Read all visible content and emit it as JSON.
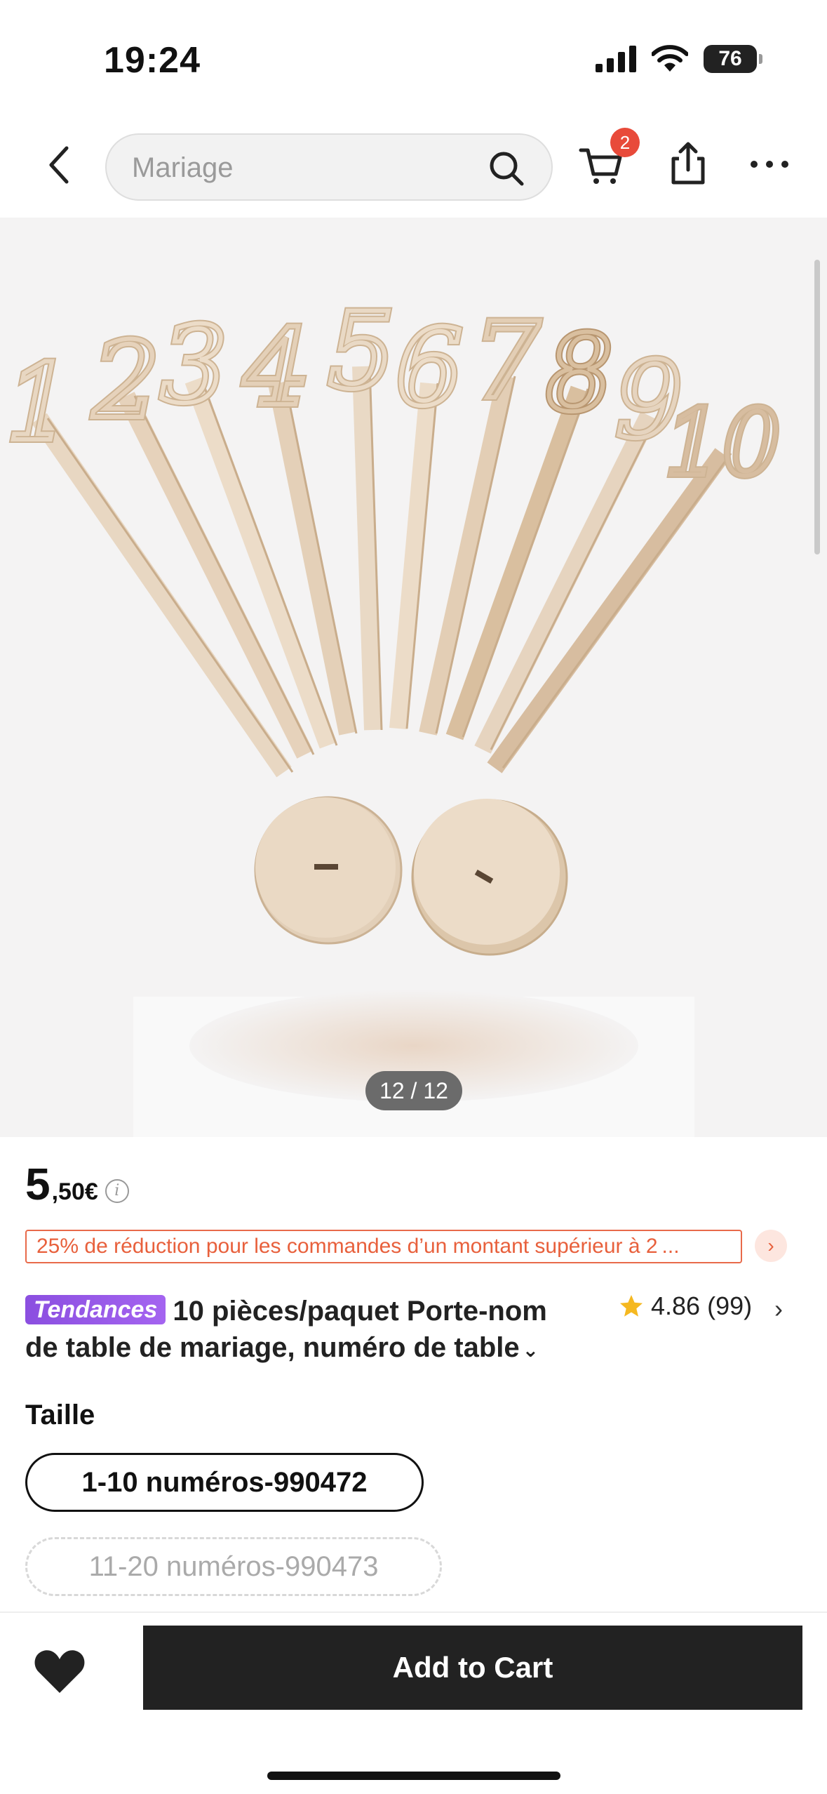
{
  "status_bar": {
    "time": "19:24",
    "battery": "76"
  },
  "nav": {
    "search_placeholder": "Mariage",
    "cart_count": "2"
  },
  "gallery": {
    "image_counter": "12 / 12",
    "numbers": [
      "1",
      "2",
      "3",
      "4",
      "5",
      "6",
      "7",
      "8",
      "9",
      "10"
    ]
  },
  "product": {
    "price_int": "5",
    "price_dec": ",50€",
    "info_symbol": "i",
    "promo_text": "25% de réduction pour les commandes d’un montant supérieur à 2 ...",
    "promo_arrow": "›",
    "trend_badge": "Tendances",
    "title": "10 pièces/paquet Porte-nom de table de mariage, numéro de table",
    "title_ellipsis": "⌄",
    "rating_value": "4.86",
    "rating_count": "(99)",
    "rating_arrow": "›"
  },
  "size": {
    "label": "Taille",
    "options": [
      "1-10 numéros-990472",
      "11-20 numéros-990473"
    ],
    "selected_index": 0
  },
  "bottom_bar": {
    "add_to_cart_label": "Add to Cart"
  },
  "colors": {
    "accent_badge": "#e84a3a",
    "promo": "#e8603c",
    "trend_badge": "#9a5ae8",
    "cta_background": "#222222",
    "star": "#f5b820"
  }
}
